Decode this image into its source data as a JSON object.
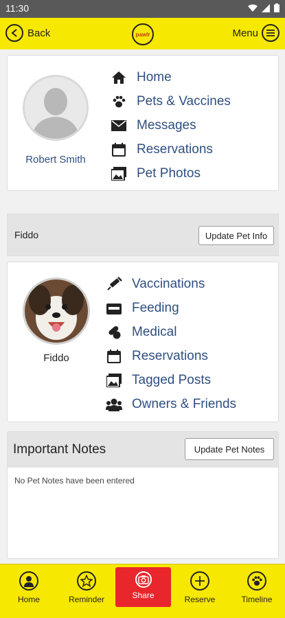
{
  "status_bar": {
    "time": "11:30"
  },
  "header": {
    "back_label": "Back",
    "menu_label": "Menu",
    "logo_text": "pawlr"
  },
  "owner": {
    "name": "Robert Smith"
  },
  "owner_nav": [
    {
      "label": "Home",
      "icon": "home-icon"
    },
    {
      "label": "Pets & Vaccines",
      "icon": "paw-icon"
    },
    {
      "label": "Messages",
      "icon": "envelope-icon"
    },
    {
      "label": "Reservations",
      "icon": "calendar-icon"
    },
    {
      "label": "Pet Photos",
      "icon": "photos-icon"
    }
  ],
  "pet_bar": {
    "name": "Fiddo",
    "update_button": "Update Pet Info"
  },
  "pet": {
    "name": "Fiddo"
  },
  "pet_nav": [
    {
      "label": "Vaccinations",
      "icon": "syringe-icon"
    },
    {
      "label": "Feeding",
      "icon": "feeding-icon"
    },
    {
      "label": "Medical",
      "icon": "pills-icon"
    },
    {
      "label": "Reservations",
      "icon": "calendar-icon"
    },
    {
      "label": "Tagged Posts",
      "icon": "photos-icon"
    },
    {
      "label": "Owners & Friends",
      "icon": "users-icon"
    }
  ],
  "notes": {
    "title": "Important Notes",
    "update_button": "Update Pet Notes",
    "empty_text": "No Pet Notes have been entered"
  },
  "bottom_nav": [
    {
      "label": "Home",
      "icon": "user-icon"
    },
    {
      "label": "Reminder",
      "icon": "star-icon"
    },
    {
      "label": "Share",
      "icon": "camera-icon",
      "active": true
    },
    {
      "label": "Reserve",
      "icon": "plus-icon"
    },
    {
      "label": "Timeline",
      "icon": "paw-icon"
    }
  ],
  "colors": {
    "header_yellow": "#f7e800",
    "link_blue": "#2f4f80",
    "share_red": "#e8262c"
  }
}
